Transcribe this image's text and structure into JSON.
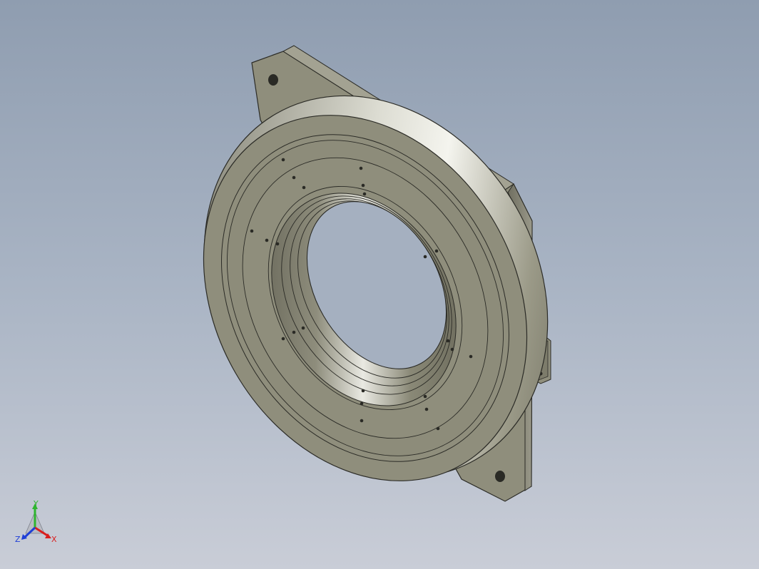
{
  "viewport": {
    "background_top": "#8f9db0",
    "background_bottom": "#c9cdd7",
    "model_color": "#8f8e7c",
    "model_edge_color": "#2b2b26"
  },
  "triad": {
    "y_label": "Y",
    "x_label": "X",
    "z_label": "Z",
    "x_color": "#d91e1e",
    "y_color": "#2fb52f",
    "z_color": "#1f3fd6"
  }
}
